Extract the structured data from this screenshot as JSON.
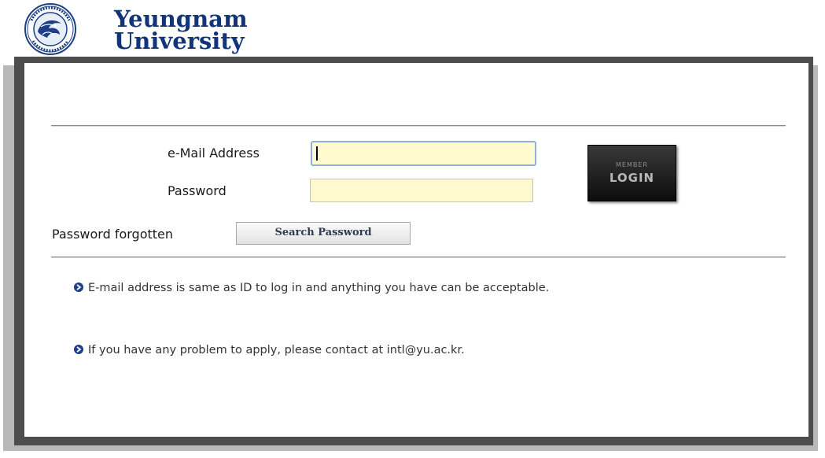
{
  "logo": {
    "line1": "Yeungnam",
    "line2": "University",
    "seal_icon": "university-seal-icon",
    "brand_color": "#12357a"
  },
  "form": {
    "email_label": "e-Mail Address",
    "email_value": "",
    "password_label": "Password",
    "password_value": "",
    "field_background": "#fff9cf"
  },
  "login_button": {
    "small_text": "MEMBER",
    "big_text": "LOGIN"
  },
  "forgot": {
    "label": "Password forgotten",
    "button_label": "Search Password"
  },
  "notes": [
    {
      "icon": "arrow-bullet-icon",
      "text": "E-mail address is same as ID to log in and anything you have can be acceptable."
    },
    {
      "icon": "arrow-bullet-icon",
      "text": "If you have any problem to apply, please contact at intl@yu.ac.kr."
    }
  ],
  "colors": {
    "bullet": "#1d3f8c",
    "frame_dark": "#4d4d4d",
    "frame_light": "#b9b9b9"
  }
}
